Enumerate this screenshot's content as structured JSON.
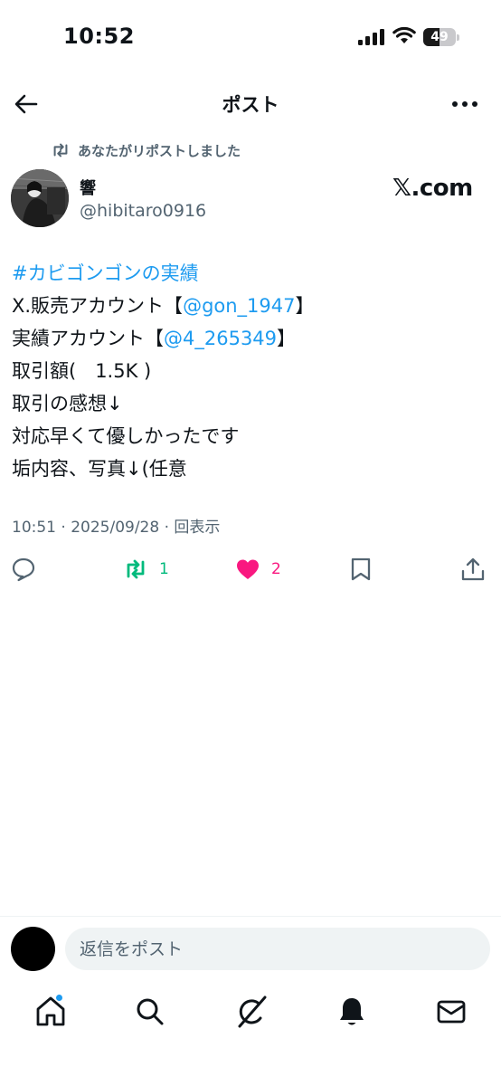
{
  "status_bar": {
    "time": "10:52",
    "battery_level": "49",
    "battery_fraction": 0.49
  },
  "nav": {
    "title": "ポスト"
  },
  "repost_banner": {
    "text": "あなたがリポストしました"
  },
  "author": {
    "display_name": "響",
    "handle": "@hibitaro0916",
    "badge_text": "𝕏.com"
  },
  "tweet": {
    "hashtag": "#カビゴンゴンの実績",
    "line2_prefix": "X.販売アカウント【",
    "line2_mention": "@gon_1947",
    "line2_suffix": "】",
    "line3_prefix": "実績アカウント【",
    "line3_mention": "@4_265349",
    "line3_suffix": "】",
    "line4": "取引額(　1.5K  )",
    "line5": "取引の感想↓",
    "line6": "対応早くて優しかったです",
    "line7": "垢内容、写真↓(任意"
  },
  "meta": {
    "text": "10:51 · 2025/09/28 · 回表示"
  },
  "actions": {
    "reply_icon": "reply-icon",
    "repost_count": "1",
    "like_count": "2",
    "bookmark_icon": "bookmark-icon",
    "share_icon": "share-icon"
  },
  "compose": {
    "placeholder": "返信をポスト"
  },
  "tabbar": {
    "items": [
      "home-icon",
      "search-icon",
      "grok-icon",
      "notifications-icon",
      "messages-icon"
    ]
  },
  "colors": {
    "accent": "#1d9bf0",
    "repost_active": "#00ba7c",
    "like_active": "#f91880",
    "secondary_text": "#536471",
    "primary_text": "#0f1419"
  }
}
